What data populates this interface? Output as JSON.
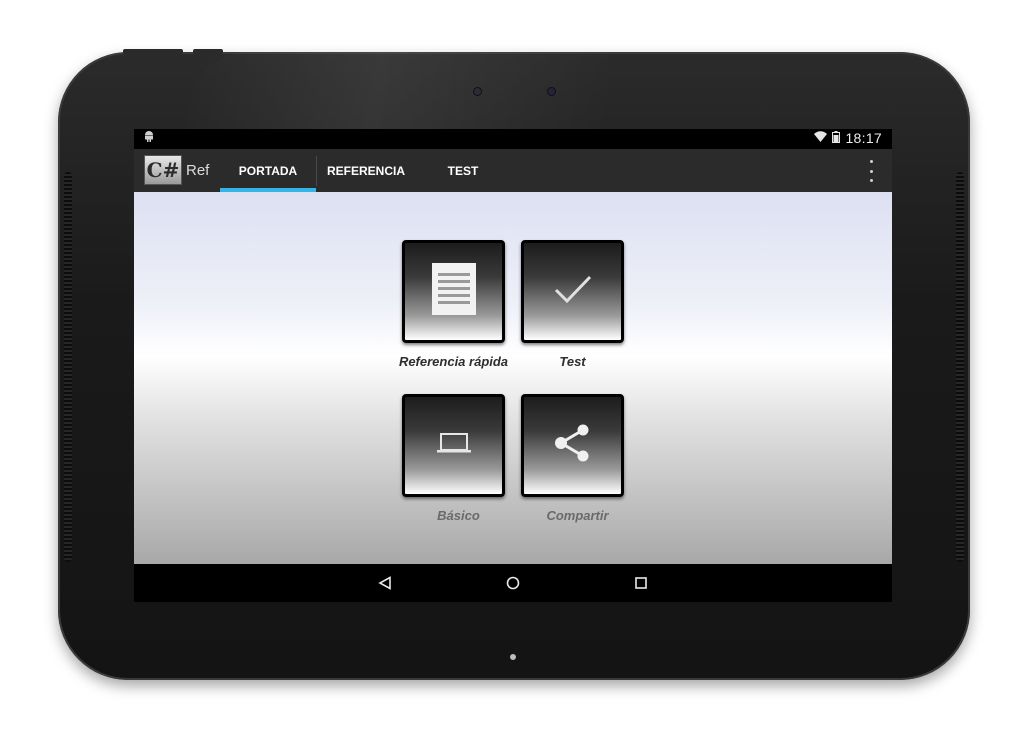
{
  "status_bar": {
    "left_icon": "android-notification-icon",
    "wifi_icon": "wifi-icon",
    "battery_icon": "battery-icon",
    "time": "18:17"
  },
  "action_bar": {
    "logo_text": "C#",
    "title": "Ref",
    "tabs": [
      {
        "label": "PORTADA",
        "active": true
      },
      {
        "label": "REFERENCIA",
        "active": false
      },
      {
        "label": "TEST",
        "active": false
      }
    ],
    "accent_color": "#33b5e5"
  },
  "grid": {
    "tiles": [
      {
        "label": "Referencia rápida",
        "icon": "document-icon"
      },
      {
        "label": "Test",
        "icon": "checkmark-icon"
      },
      {
        "label": "Básico",
        "icon": "laptop-icon"
      },
      {
        "label": "Compartir",
        "icon": "share-icon"
      }
    ]
  },
  "nav_bar": {
    "back_icon": "back-icon",
    "home_icon": "home-icon",
    "recents_icon": "recents-icon"
  }
}
